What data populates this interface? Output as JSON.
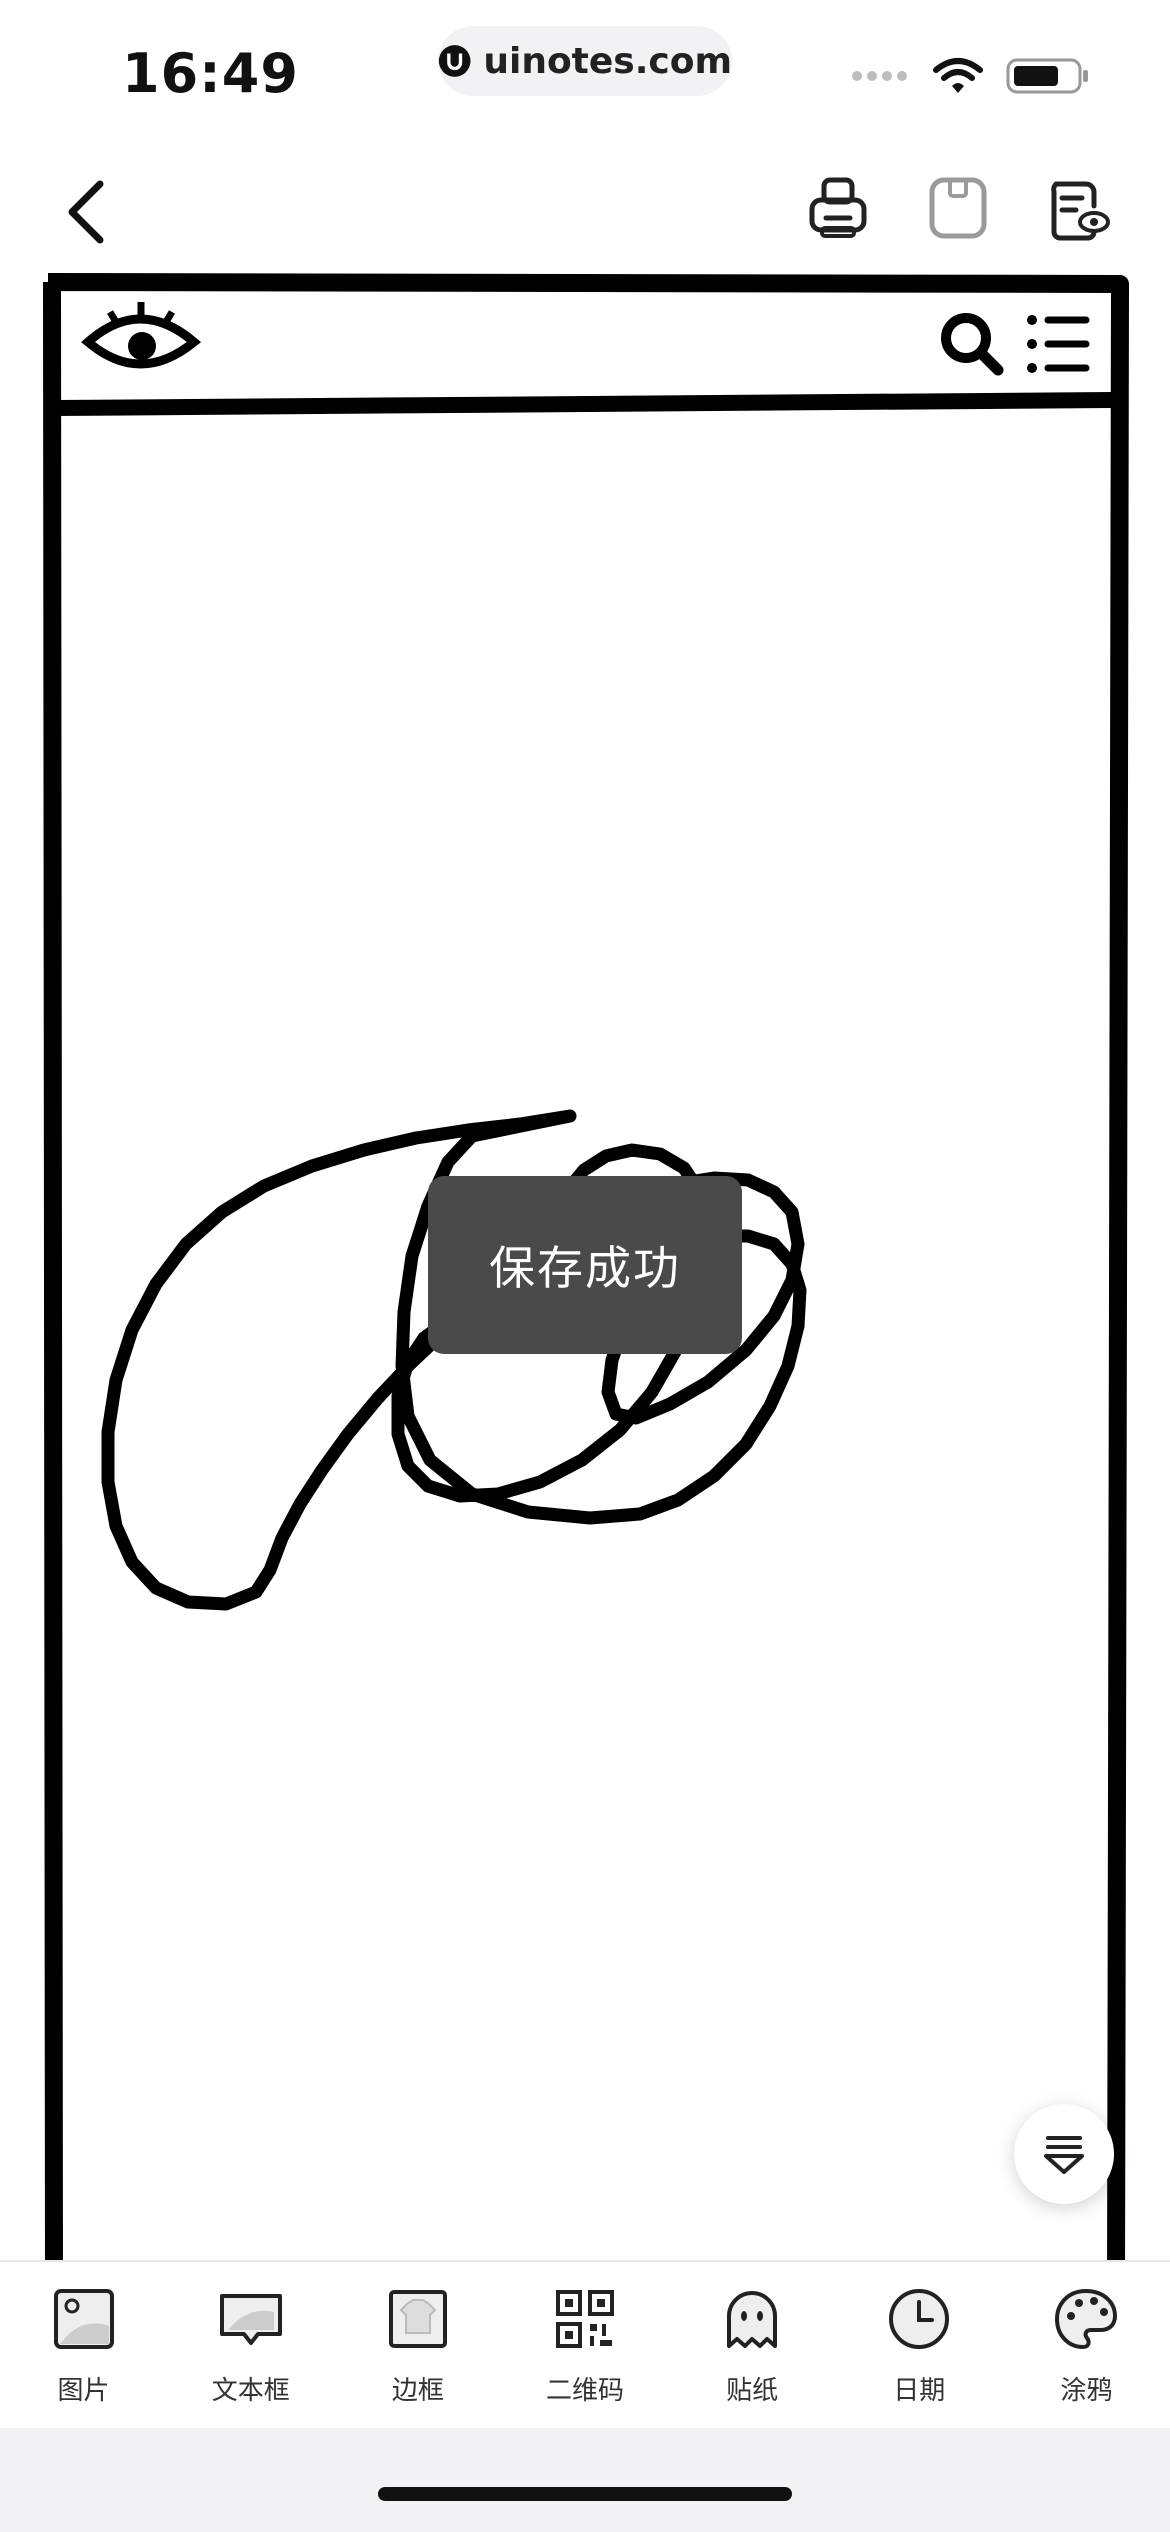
{
  "status": {
    "time": "16:49",
    "url": "uinotes.com",
    "icons": [
      "signal-dots-icon",
      "wifi-icon",
      "battery-icon"
    ]
  },
  "nav": {
    "icons": [
      "back-chevron-icon",
      "print-icon",
      "save-icon",
      "preview-icon"
    ]
  },
  "toast": {
    "text": "保存成功"
  },
  "float_button": {
    "icon": "layers-icon"
  },
  "toolbar": {
    "items": [
      {
        "label": "图片",
        "icon": "image-icon"
      },
      {
        "label": "文本框",
        "icon": "textbox-icon"
      },
      {
        "label": "边框",
        "icon": "frame-icon"
      },
      {
        "label": "二维码",
        "icon": "qrcode-icon"
      },
      {
        "label": "贴纸",
        "icon": "ghost-sticker-icon"
      },
      {
        "label": "日期",
        "icon": "clock-icon"
      },
      {
        "label": "涂鸦",
        "icon": "palette-icon"
      }
    ]
  }
}
